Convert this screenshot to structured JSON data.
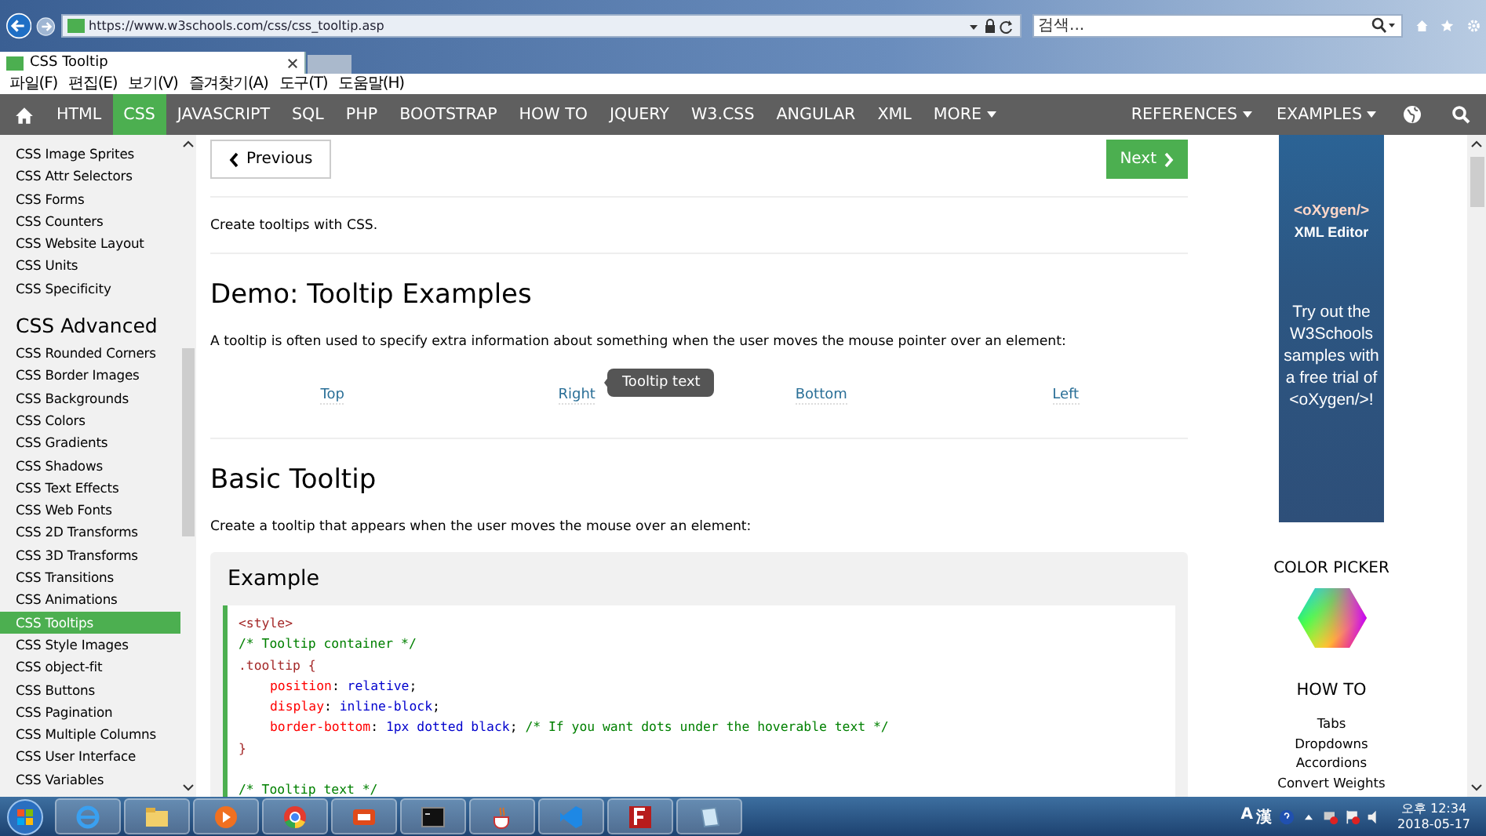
{
  "browser": {
    "url": "https://www.w3schools.com/css/css_tooltip.asp",
    "search": {
      "placeholder": "검색..."
    },
    "tab": {
      "title": "CSS Tooltip"
    },
    "menu": [
      "파일(F)",
      "편집(E)",
      "보기(V)",
      "즐겨찾기(A)",
      "도구(T)",
      "도움말(H)"
    ]
  },
  "nav": {
    "items": [
      {
        "label": "HTML",
        "selected": false,
        "dropdown": false
      },
      {
        "label": "CSS",
        "selected": true,
        "dropdown": false
      },
      {
        "label": "JAVASCRIPT",
        "selected": false,
        "dropdown": false
      },
      {
        "label": "SQL",
        "selected": false,
        "dropdown": false
      },
      {
        "label": "PHP",
        "selected": false,
        "dropdown": false
      },
      {
        "label": "BOOTSTRAP",
        "selected": false,
        "dropdown": false
      },
      {
        "label": "HOW TO",
        "selected": false,
        "dropdown": false
      },
      {
        "label": "JQUERY",
        "selected": false,
        "dropdown": false
      },
      {
        "label": "W3.CSS",
        "selected": false,
        "dropdown": false
      },
      {
        "label": "ANGULAR",
        "selected": false,
        "dropdown": false
      },
      {
        "label": "XML",
        "selected": false,
        "dropdown": false
      },
      {
        "label": "MORE",
        "selected": false,
        "dropdown": true
      }
    ],
    "right_items": [
      {
        "label": "REFERENCES",
        "dropdown": true
      },
      {
        "label": "EXAMPLES",
        "dropdown": true
      }
    ]
  },
  "sidebar": {
    "items": [
      {
        "label": "CSS Image Sprites",
        "selected": false
      },
      {
        "label": "CSS Attr Selectors",
        "selected": false
      },
      {
        "label": "CSS Forms",
        "selected": false
      },
      {
        "label": "CSS Counters",
        "selected": false
      },
      {
        "label": "CSS Website Layout",
        "selected": false
      },
      {
        "label": "CSS Units",
        "selected": false
      },
      {
        "label": "CSS Specificity",
        "selected": false
      }
    ],
    "heading": "CSS Advanced",
    "advanced_items": [
      {
        "label": "CSS Rounded Corners",
        "selected": false
      },
      {
        "label": "CSS Border Images",
        "selected": false
      },
      {
        "label": "CSS Backgrounds",
        "selected": false
      },
      {
        "label": "CSS Colors",
        "selected": false
      },
      {
        "label": "CSS Gradients",
        "selected": false
      },
      {
        "label": "CSS Shadows",
        "selected": false
      },
      {
        "label": "CSS Text Effects",
        "selected": false
      },
      {
        "label": "CSS Web Fonts",
        "selected": false
      },
      {
        "label": "CSS 2D Transforms",
        "selected": false
      },
      {
        "label": "CSS 3D Transforms",
        "selected": false
      },
      {
        "label": "CSS Transitions",
        "selected": false
      },
      {
        "label": "CSS Animations",
        "selected": false
      },
      {
        "label": "CSS Tooltips",
        "selected": true
      },
      {
        "label": "CSS Style Images",
        "selected": false
      },
      {
        "label": "CSS object-fit",
        "selected": false
      },
      {
        "label": "CSS Buttons",
        "selected": false
      },
      {
        "label": "CSS Pagination",
        "selected": false
      },
      {
        "label": "CSS Multiple Columns",
        "selected": false
      },
      {
        "label": "CSS User Interface",
        "selected": false
      },
      {
        "label": "CSS Variables",
        "selected": false
      }
    ]
  },
  "main": {
    "previous": "Previous",
    "next": "Next",
    "intro": "Create tooltips with CSS.",
    "demo_heading": "Demo: Tooltip Examples",
    "demo_text": "A tooltip is often used to specify extra information about something when the user moves the mouse pointer over an element:",
    "demo_links": [
      {
        "label": "Top"
      },
      {
        "label": "Right",
        "tooltip": "Tooltip text"
      },
      {
        "label": "Bottom"
      },
      {
        "label": "Left"
      }
    ],
    "basic_heading": "Basic Tooltip",
    "basic_text": "Create a tooltip that appears when the user moves the mouse over an element:",
    "example": {
      "title": "Example",
      "lines": [
        {
          "kind": "code",
          "indented": false,
          "segments": [
            {
              "kind": "tag",
              "text": "<style>"
            }
          ]
        },
        {
          "kind": "code",
          "indented": false,
          "segments": [
            {
              "kind": "comment",
              "text": "/* Tooltip container */"
            }
          ]
        },
        {
          "kind": "code",
          "indented": false,
          "segments": [
            {
              "kind": "selector",
              "text": ".tooltip {"
            }
          ]
        },
        {
          "kind": "code",
          "indented": true,
          "segments": [
            {
              "kind": "prop",
              "text": "position"
            },
            {
              "kind": "plain",
              "text": ": "
            },
            {
              "kind": "value",
              "text": "relative"
            },
            {
              "kind": "plain",
              "text": ";"
            }
          ]
        },
        {
          "kind": "code",
          "indented": true,
          "segments": [
            {
              "kind": "prop",
              "text": "display"
            },
            {
              "kind": "plain",
              "text": ": "
            },
            {
              "kind": "value",
              "text": "inline-block"
            },
            {
              "kind": "plain",
              "text": ";"
            }
          ]
        },
        {
          "kind": "code",
          "indented": true,
          "segments": [
            {
              "kind": "prop",
              "text": "border-bottom"
            },
            {
              "kind": "plain",
              "text": ": "
            },
            {
              "kind": "value",
              "text": "1px dotted black"
            },
            {
              "kind": "plain",
              "text": "; "
            },
            {
              "kind": "comment",
              "text": "/* If you want dots under the hoverable text */"
            }
          ]
        },
        {
          "kind": "code",
          "indented": false,
          "segments": [
            {
              "kind": "selector",
              "text": "}"
            }
          ]
        },
        {
          "kind": "blank"
        },
        {
          "kind": "code",
          "indented": false,
          "segments": [
            {
              "kind": "comment",
              "text": "/* Tooltip text */"
            }
          ]
        }
      ]
    }
  },
  "aside": {
    "ad": {
      "brand": "<oXygen/>",
      "product": "XML Editor",
      "text": "Try out the W3Schools samples with a free trial of <oXygen/>!"
    },
    "color_picker": "COLOR PICKER",
    "howto_heading": "HOW TO",
    "howto_links": [
      "Tabs",
      "Dropdowns",
      "Accordions",
      "Convert Weights"
    ]
  },
  "taskbar": {
    "ime": [
      "A",
      "漢"
    ],
    "time": "오후 12:34",
    "date": "2018-05-17"
  }
}
